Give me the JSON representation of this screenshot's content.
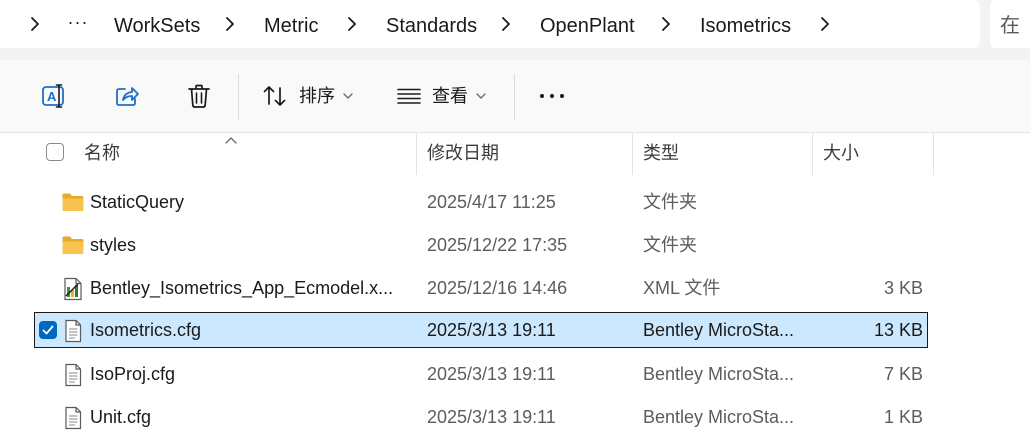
{
  "address_bar": {
    "more_label": "···",
    "crumbs": [
      "WorkSets",
      "Metric",
      "Standards",
      "OpenPlant",
      "Isometrics"
    ],
    "search_placeholder_fragment": "在"
  },
  "command_bar": {
    "rename_icon": "rename-icon",
    "share_icon": "share-icon",
    "delete_icon": "trash-icon",
    "sort_label": "排序",
    "view_label": "查看",
    "more_label": "···"
  },
  "columns": {
    "name": "名称",
    "date": "修改日期",
    "type": "类型",
    "size": "大小"
  },
  "files": [
    {
      "name": "StaticQuery",
      "date": "2025/4/17 11:25",
      "type": "文件夹",
      "size": "",
      "icon": "folder-icon",
      "selected": false
    },
    {
      "name": "styles",
      "date": "2025/12/22 17:35",
      "type": "文件夹",
      "size": "",
      "icon": "folder-icon",
      "selected": false
    },
    {
      "name": "Bentley_Isometrics_App_Ecmodel.x...",
      "date": "2025/12/16 14:46",
      "type": "XML 文件",
      "size": "3 KB",
      "icon": "xml-file-icon",
      "selected": false
    },
    {
      "name": "Isometrics.cfg",
      "date": "2025/3/13 19:11",
      "type": "Bentley MicroSta...",
      "size": "13 KB",
      "icon": "document-icon",
      "selected": true
    },
    {
      "name": "IsoProj.cfg",
      "date": "2025/3/13 19:11",
      "type": "Bentley MicroSta...",
      "size": "7 KB",
      "icon": "document-icon",
      "selected": false
    },
    {
      "name": "Unit.cfg",
      "date": "2025/3/13 19:11",
      "type": "Bentley MicroSta...",
      "size": "1 KB",
      "icon": "document-icon",
      "selected": false
    }
  ],
  "colors": {
    "selection_bg": "#cce8ff",
    "accent": "#0067c0",
    "folder": "#f8c44f"
  }
}
